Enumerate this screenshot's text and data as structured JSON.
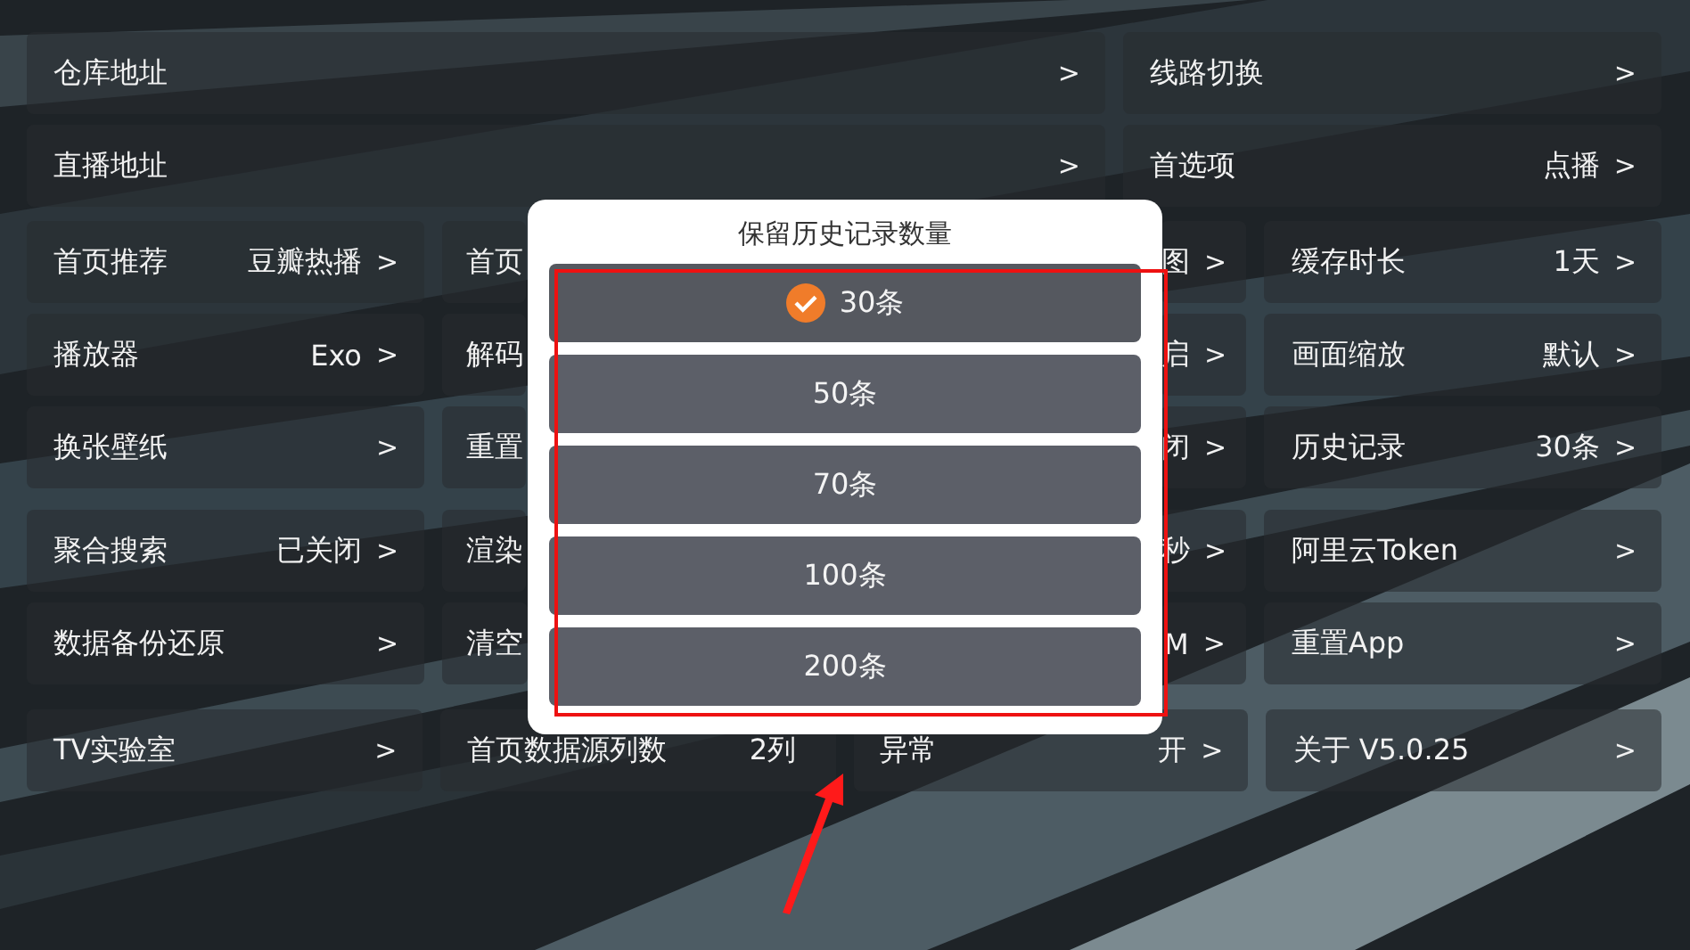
{
  "top_rows": [
    {
      "main": {
        "label": "仓库地址",
        "chevron": ">"
      },
      "side": {
        "label": "线路切换",
        "chevron": ">"
      }
    },
    {
      "main": {
        "label": "直播地址",
        "chevron": ">"
      },
      "side": {
        "label": "首选项",
        "value": "点播",
        "chevron": ">"
      }
    }
  ],
  "grid_rows": [
    {
      "cells": [
        {
          "kind": "full",
          "label": "首页推荐",
          "value": "豆瓣热播",
          "chevron": ">"
        },
        {
          "kind": "left-part",
          "label": "首页"
        },
        {
          "kind": "right-part",
          "value": "图",
          "chevron": ">"
        },
        {
          "kind": "full",
          "label": "缓存时长",
          "value": "1天",
          "chevron": ">"
        }
      ]
    },
    {
      "cells": [
        {
          "kind": "full",
          "label": "播放器",
          "value": "Exo",
          "chevron": ">"
        },
        {
          "kind": "left-part",
          "label": "解码"
        },
        {
          "kind": "right-part",
          "value": "启",
          "chevron": ">"
        },
        {
          "kind": "full",
          "label": "画面缩放",
          "value": "默认",
          "chevron": ">"
        }
      ]
    },
    {
      "cells": [
        {
          "kind": "full",
          "label": "换张壁纸",
          "chevron": ">"
        },
        {
          "kind": "left-part",
          "label": "重置"
        },
        {
          "kind": "right-part",
          "value": "闭",
          "chevron": ">"
        },
        {
          "kind": "full",
          "label": "历史记录",
          "value": "30条",
          "chevron": ">"
        }
      ]
    },
    {
      "cells": [
        {
          "kind": "full",
          "label": "聚合搜索",
          "value": "已关闭",
          "chevron": ">"
        },
        {
          "kind": "left-part",
          "label": "渲染"
        },
        {
          "kind": "right-part",
          "value": "秒",
          "chevron": ">"
        },
        {
          "kind": "full",
          "label": "阿里云Token",
          "chevron": ">"
        }
      ]
    },
    {
      "cells": [
        {
          "kind": "full",
          "label": "数据备份还原",
          "chevron": ">"
        },
        {
          "kind": "left-part",
          "label": "清空"
        },
        {
          "kind": "right-part",
          "value": "M",
          "chevron": ">"
        },
        {
          "kind": "full",
          "label": "重置App",
          "chevron": ">"
        }
      ]
    },
    {
      "cells": [
        {
          "kind": "full",
          "label": "TV实验室",
          "chevron": ">"
        },
        {
          "kind": "full",
          "label": "首页数据源列数",
          "value": "2列"
        },
        {
          "kind": "full",
          "label": "异常",
          "value": "开",
          "chevron": ">"
        },
        {
          "kind": "full",
          "label": "关于  V5.0.25",
          "chevron": ">"
        }
      ]
    }
  ],
  "dialog": {
    "title": "保留历史记录数量",
    "options": [
      {
        "label": "30条",
        "selected": true
      },
      {
        "label": "50条",
        "selected": false
      },
      {
        "label": "70条",
        "selected": false
      },
      {
        "label": "100条",
        "selected": false
      },
      {
        "label": "200条",
        "selected": false
      }
    ]
  }
}
